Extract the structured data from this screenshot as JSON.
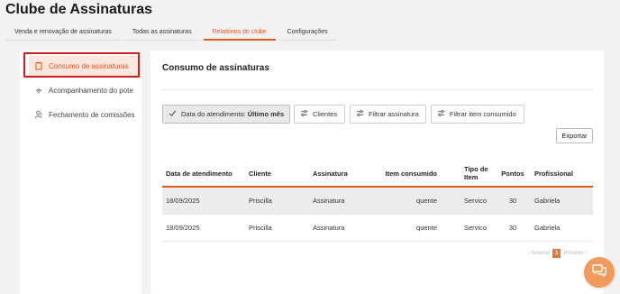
{
  "app": {
    "title": "Clube de Assinaturas"
  },
  "tabs": [
    {
      "label": "Venda e renovação de assinaturas"
    },
    {
      "label": "Todas as assinaturas"
    },
    {
      "label": "Relatórios do clube"
    },
    {
      "label": "Configurações"
    }
  ],
  "sidebar": {
    "items": [
      {
        "label": "Consumo de assinaturas",
        "icon": "clipboard-icon"
      },
      {
        "label": "Acompanhamento do pote",
        "icon": "signal-icon"
      },
      {
        "label": "Fechamento de comissões",
        "icon": "user-money-icon"
      }
    ]
  },
  "main": {
    "title": "Consumo de assinaturas",
    "filters": {
      "date_label": "Data do atendimento:",
      "date_value": "Último mês",
      "clients": "Clientes",
      "subscription": "Filtrar assinatura",
      "consumed_item": "Filtrar item consumido"
    },
    "export_label": "Exportar"
  },
  "table": {
    "headers": [
      "Data de atendimento",
      "Cliente",
      "Assinatura",
      "Item consumido",
      "Tipo de Item",
      "Pontos",
      "Profissional"
    ],
    "rows": [
      [
        "18/09/2025",
        "Priscilla",
        "Assinatura",
        "quente",
        "Servico",
        "30",
        "Gabriela"
      ],
      [
        "18/09/2025",
        "Priscilla",
        "Assinatura",
        "quente",
        "Servico",
        "30",
        "Gabriela"
      ]
    ]
  },
  "pagination": {
    "prev": "‹ Anterior",
    "page": "1",
    "next": "Próximo ›"
  },
  "colors": {
    "accent": "#e05a1c",
    "highlight_border": "#cc2020",
    "chat_button": "#f29a5c"
  }
}
